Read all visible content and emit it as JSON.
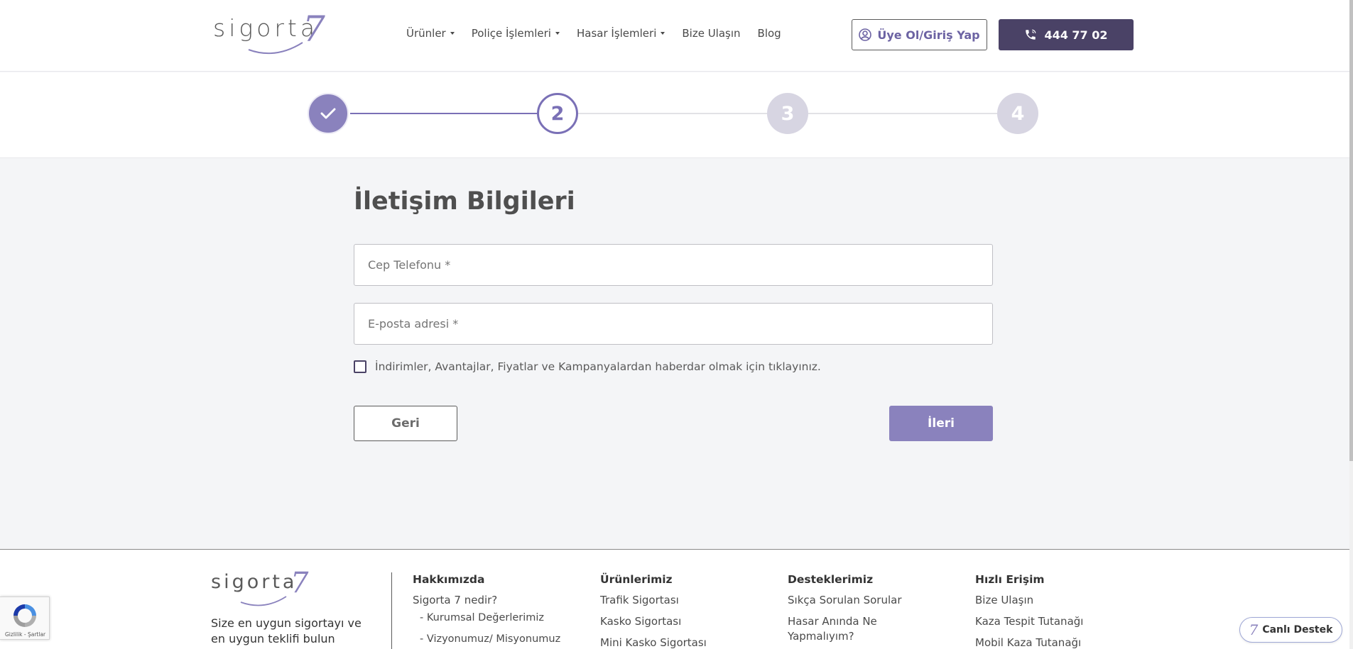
{
  "brand": {
    "logo_text": "sigorta",
    "logo_seven": "7",
    "accent": "#8a82bd",
    "dark": "#4a4266"
  },
  "nav": {
    "items": [
      {
        "label": "Ürünler",
        "has_dropdown": true
      },
      {
        "label": "Poliçe İşlemleri",
        "has_dropdown": true
      },
      {
        "label": "Hasar İşlemleri",
        "has_dropdown": true
      },
      {
        "label": "Bize Ulaşın",
        "has_dropdown": false
      },
      {
        "label": "Blog",
        "has_dropdown": false
      }
    ],
    "login_label": "Üye Ol/Giriş Yap",
    "phone_label": "444 77 02"
  },
  "stepper": {
    "steps": [
      {
        "label": "",
        "state": "done"
      },
      {
        "label": "2",
        "state": "current"
      },
      {
        "label": "3",
        "state": "todo"
      },
      {
        "label": "4",
        "state": "todo"
      }
    ]
  },
  "form": {
    "title": "İletişim Bilgileri",
    "phone_placeholder": "Cep Telefonu *",
    "phone_value": "",
    "email_placeholder": "E-posta adresi *",
    "email_value": "",
    "consent_label": "İndirimler, Avantajlar, Fiyatlar ve Kampanyalardan haberdar olmak için tıklayınız.",
    "consent_checked": false,
    "back_label": "Geri",
    "next_label": "İleri"
  },
  "footer": {
    "tagline": "Size en uygun sigortayı ve en uygun teklifi bulun",
    "columns": [
      {
        "head": "Hakkımızda",
        "links": [
          "Sigorta 7 nedir?",
          "- Kurumsal Değerlerimiz",
          "- Vizyonumuz/ Misyonumuz"
        ]
      },
      {
        "head": "Ürünlerimiz",
        "links": [
          "Trafik Sigortası",
          "Kasko Sigortası",
          "Mini Kasko Sigortası"
        ]
      },
      {
        "head": "Desteklerimiz",
        "links": [
          "Sıkça Sorulan Sorular",
          "Hasar Anında Ne Yapmalıyım?"
        ]
      },
      {
        "head": "Hızlı Erişim",
        "links": [
          "Bize Ulaşın",
          "Kaza Tespit Tutanağı",
          "Mobil Kaza Tutanağı"
        ]
      }
    ]
  },
  "recaptcha": {
    "label": "Gizlilik - Şartlar"
  },
  "live_support": {
    "label": "Canlı Destek",
    "seven": "7"
  }
}
